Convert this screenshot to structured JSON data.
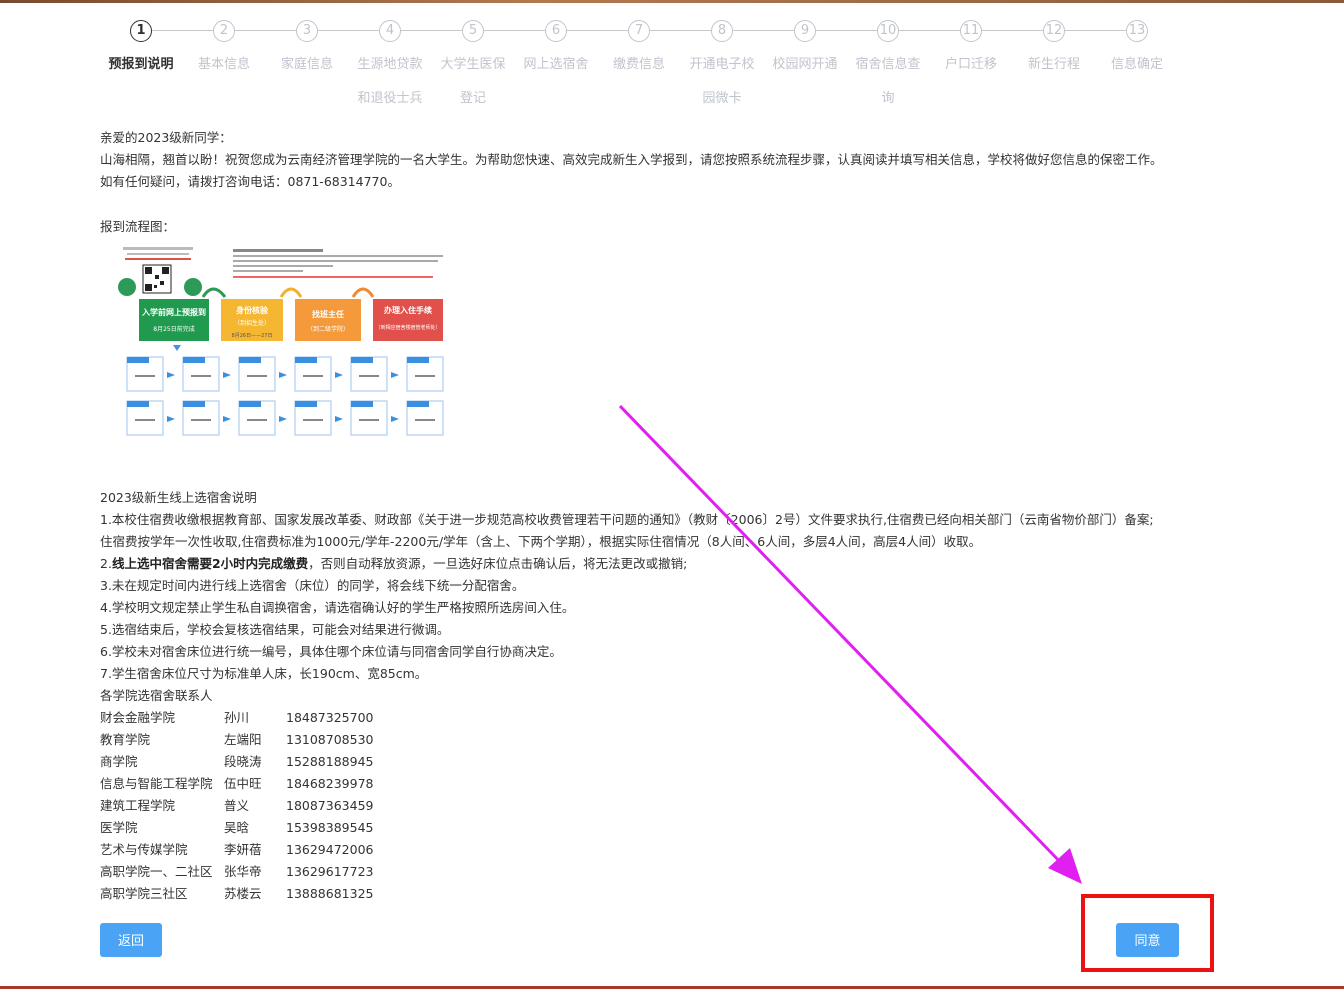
{
  "stepper": {
    "steps": [
      {
        "num": "1",
        "line1": "预报到说明",
        "line2": ""
      },
      {
        "num": "2",
        "line1": "基本信息",
        "line2": ""
      },
      {
        "num": "3",
        "line1": "家庭信息",
        "line2": ""
      },
      {
        "num": "4",
        "line1": "生源地贷款",
        "line2": "和退役士兵"
      },
      {
        "num": "5",
        "line1": "大学生医保",
        "line2": "登记"
      },
      {
        "num": "6",
        "line1": "网上选宿舍",
        "line2": ""
      },
      {
        "num": "7",
        "line1": "缴费信息",
        "line2": ""
      },
      {
        "num": "8",
        "line1": "开通电子校",
        "line2": "园微卡"
      },
      {
        "num": "9",
        "line1": "校园网开通",
        "line2": ""
      },
      {
        "num": "10",
        "line1": "宿舍信息查",
        "line2": "询"
      },
      {
        "num": "11",
        "line1": "户口迁移",
        "line2": ""
      },
      {
        "num": "12",
        "line1": "新生行程",
        "line2": ""
      },
      {
        "num": "13",
        "line1": "信息确定",
        "line2": ""
      }
    ],
    "active_index": 0
  },
  "intro": {
    "greeting": "亲爱的2023级新同学：",
    "line1": "山海相隔，翘首以盼！祝贺您成为云南经济管理学院的一名大学生。为帮助您快速、高效完成新生入学报到，请您按照系统流程步骤，认真阅读并填写相关信息，学校将做好您信息的保密工作。",
    "line2": "如有任何疑问，请拨打咨询电话：0871-68314770。"
  },
  "flow": {
    "label": "报到流程图：",
    "stage1": "入学前网上预报到",
    "stage1_sub": "8月25日前完成",
    "stage2": "身份核验",
    "stage2_sub": "（到招生处）",
    "stage2_date": "8月26日——27日",
    "stage3": "找班主任",
    "stage3_sub": "（到二级学院）",
    "stage4": "办理入住手续",
    "stage4_sub": "（到相应宿舍楼宿管老师处）"
  },
  "rules": {
    "title": "2023级新生线上选宿舍说明",
    "r1": "1.本校住宿费收缴根据教育部、国家发展改革委、财政部《关于进一步规范高校收费管理若干问题的通知》（教财〔2006〕2号）文件要求执行,住宿费已经向相关部门（云南省物价部门）备案;",
    "r1b": "住宿费按学年一次性收取,住宿费标准为1000元/学年-2200元/学年（含上、下两个学期），根据实际住宿情况（8人间、6人间，多层4人间，高层4人间）收取。",
    "r2_bold": "线上选中宿舍需要2小时内完成缴费",
    "r2_prefix": "2.",
    "r2_rest": "，否则自动释放资源，一旦选好床位点击确认后，将无法更改或撤销;",
    "r3": "3.未在规定时间内进行线上选宿舍（床位）的同学，将会线下统一分配宿舍。",
    "r4": "4.学校明文规定禁止学生私自调换宿舍，请选宿确认好的学生严格按照所选房间入住。",
    "r5": "5.选宿结束后，学校会复核选宿结果，可能会对结果进行微调。",
    "r6": "6.学校未对宿舍床位进行统一编号，具体住哪个床位请与同宿舍同学自行协商决定。",
    "r7": "7.学生宿舍床位尺寸为标准单人床，长190cm、宽85cm。",
    "contacts_title": "各学院选宿舍联系人"
  },
  "contacts": [
    {
      "college": "财会金融学院",
      "name": "孙川",
      "phone": "18487325700"
    },
    {
      "college": "教育学院",
      "name": "左端阳",
      "phone": "13108708530"
    },
    {
      "college": "商学院",
      "name": "段晓涛",
      "phone": "15288188945"
    },
    {
      "college": "信息与智能工程学院",
      "name": "伍中旺",
      "phone": "18468239978"
    },
    {
      "college": "建筑工程学院",
      "name": "普义",
      "phone": "18087363459"
    },
    {
      "college": "医学院",
      "name": "吴晗",
      "phone": "15398389545"
    },
    {
      "college": "艺术与传媒学院",
      "name": "李妍蓓",
      "phone": "13629472006"
    },
    {
      "college": "高职学院一、二社区",
      "name": "张华帝",
      "phone": "13629617723"
    },
    {
      "college": "高职学院三社区",
      "name": "苏楼云",
      "phone": "13888681325"
    }
  ],
  "buttons": {
    "back": "返回",
    "agree": "同意"
  },
  "colors": {
    "primary": "#4aa3f5",
    "highlight_box": "#ee1111",
    "arrow": "#e020f0"
  }
}
